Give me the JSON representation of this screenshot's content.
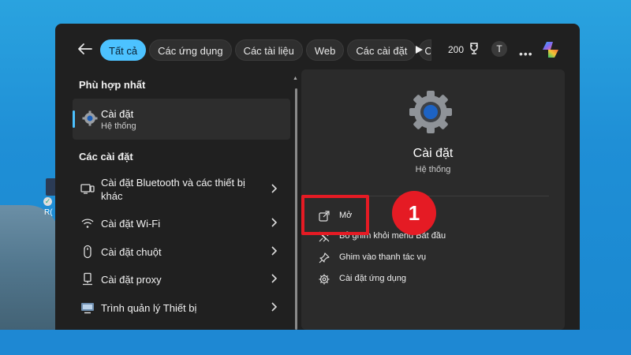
{
  "desktop": {
    "icon_label": "R("
  },
  "topbar": {
    "chips": [
      "Tất cả",
      "Các ứng dụng",
      "Các tài liệu",
      "Web",
      "Các cài đặt",
      "C"
    ],
    "points": "200",
    "avatar_initial": "T"
  },
  "left": {
    "best_match_title": "Phù hợp nhất",
    "best_match": {
      "title": "Cài đặt",
      "subtitle": "Hệ thống"
    },
    "settings_title": "Các cài đặt",
    "settings": [
      {
        "label_line1": "Cài đặt Bluetooth và các thiết bị",
        "label_line2": "khác",
        "icon": "bluetooth-devices-icon"
      },
      {
        "label": "Cài đặt Wi-Fi",
        "icon": "wifi-icon"
      },
      {
        "label": "Cài đặt chuột",
        "icon": "mouse-icon"
      },
      {
        "label": "Cài đặt proxy",
        "icon": "proxy-icon"
      },
      {
        "label": "Trình quản lý Thiết bị",
        "icon": "device-manager-icon"
      }
    ]
  },
  "panel": {
    "title": "Cài đặt",
    "subtitle": "Hệ thống",
    "actions": [
      {
        "label": "Mở",
        "icon": "open-icon"
      },
      {
        "label": "Bỏ ghim khỏi menu Bắt đầu",
        "icon": "unpin-icon"
      },
      {
        "label": "Ghim vào thanh tác vụ",
        "icon": "pin-icon"
      },
      {
        "label": "Cài đặt ứng dụng",
        "icon": "settings-gear-icon"
      }
    ]
  },
  "annotation": {
    "step_number": "1"
  },
  "colors": {
    "accent": "#4cc2ff",
    "highlight": "#e51b24",
    "menu_bg": "#202020",
    "panel_bg": "#2b2b2b"
  }
}
